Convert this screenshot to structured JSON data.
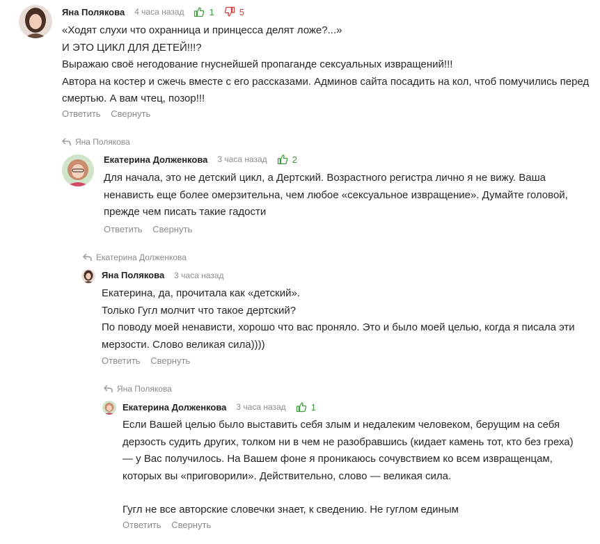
{
  "actions": {
    "reply": "Ответить",
    "collapse": "Свернуть"
  },
  "colors": {
    "like": "#3a9a3a",
    "dislike": "#d23b3b",
    "muted": "#8a8a8a"
  },
  "comments": [
    {
      "author": "Яна Полякова",
      "time": "4 часа назад",
      "likes": "1",
      "dislikes": "5",
      "lines": [
        "«Ходят слухи что охранница и принцесса делят ложе?...»",
        "И ЭТО ЦИКЛ ДЛЯ ДЕТЕЙ!!!?",
        "Выражаю своё негодование гнуснейшей пропаганде сексуальных извращений!!!",
        "Автора на костер и сжечь вместе с его рассказами. Админов сайта посадить на кол, чтоб помучились перед смертью. А вам чтец, позор!!!"
      ]
    },
    {
      "reply_to": "Яна Полякова",
      "author": "Екатерина Долженкова",
      "time": "3 часа назад",
      "likes": "2",
      "lines": [
        "Для начала, это не детский цикл, а Дертский. Возрастного регистра лично я не вижу. Ваша ненависть еще более омерзительна, чем любое «сексуальное извращение». Думайте головой, прежде чем писать такие гадости"
      ]
    },
    {
      "reply_to": "Екатерина Долженкова",
      "author": "Яна Полякова",
      "time": "3 часа назад",
      "lines": [
        "Екатерина, да, прочитала как «детский».",
        "Только Гугл молчит что такое дертский?",
        "По поводу моей ненависти, хорошо что вас проняло. Это и было моей целью, когда я писала эти мерзости. Слово великая сила))))"
      ]
    },
    {
      "reply_to": "Яна Полякова",
      "author": "Екатерина Долженкова",
      "time": "3 часа назад",
      "likes": "1",
      "lines": [
        "Если Вашей целью было выставить себя злым и недалеким человеком, берущим на себя дерзость судить других, толком ни в чем не разобравшись (кидает камень тот, кто без греха) — у Вас получилось. На Вашем фоне я проникаюсь сочувствием ко всем извращенцам, которых вы «приговорили». Действительно, слово — великая сила.",
        "Гугл не все авторские словечки знает, к сведению. Не гуглом единым"
      ]
    }
  ]
}
